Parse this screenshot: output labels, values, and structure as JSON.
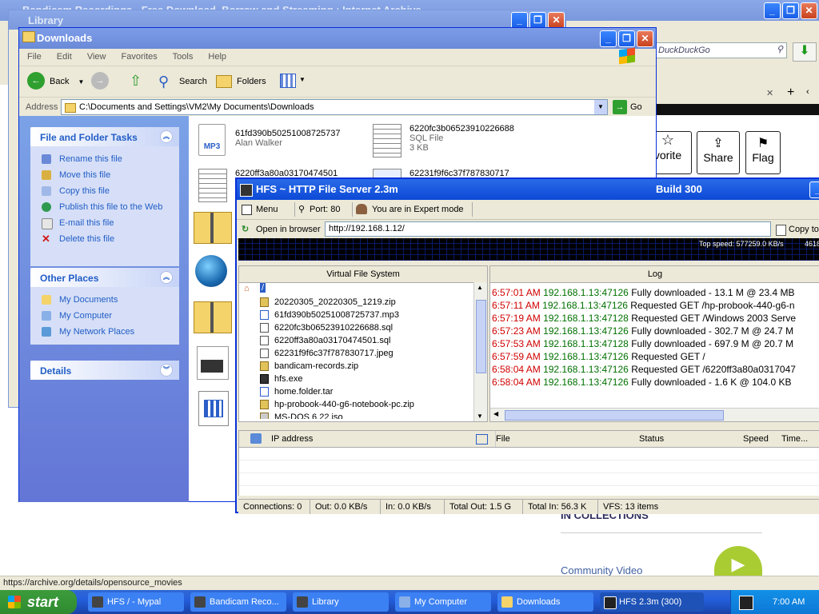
{
  "back_windows": {
    "library_title": "Library",
    "browser_title": "Bandicam Recordings - Free Download, Borrow and Streaming : Internet Archive",
    "browser_search": "DuckDuckGo",
    "browser_buttons": [
      "vorite",
      "Share",
      "Flag"
    ],
    "browser_collections": "IN COLLECTIONS",
    "browser_community": "Community Video",
    "status_url": "https://archive.org/details/opensource_movies"
  },
  "explorer": {
    "title": "Downloads",
    "menu": [
      "File",
      "Edit",
      "View",
      "Favorites",
      "Tools",
      "Help"
    ],
    "toolbar": {
      "back": "Back",
      "search": "Search",
      "folders": "Folders"
    },
    "address_label": "Address",
    "address_value": "C:\\Documents and Settings\\VM2\\My Documents\\Downloads",
    "go_label": "Go",
    "file_tasks": {
      "title": "File and Folder Tasks",
      "items": [
        "Rename this file",
        "Move this file",
        "Copy this file",
        "Publish this file to the Web",
        "E-mail this file",
        "Delete this file"
      ]
    },
    "other_places": {
      "title": "Other Places",
      "items": [
        "My Documents",
        "My Computer",
        "My Network Places"
      ]
    },
    "details_title": "Details",
    "files": [
      {
        "name": "61fd390b50251008725737",
        "sub": "Alan Walker"
      },
      {
        "name": "6220fc3b06523910226688",
        "sub": "SQL File",
        "sub2": "3 KB"
      },
      {
        "name": "6220ff3a80a03170474501"
      },
      {
        "name": "62231f9f6c37f787830717"
      }
    ]
  },
  "hfs": {
    "title": "HFS ~ HTTP File Server 2.3m",
    "build": "Build 300",
    "menu_label": "Menu",
    "port_label": "Port: 80",
    "mode_label": "You are in Expert mode",
    "open_browser": "Open in browser",
    "url": "http://192.168.1.12/",
    "copy_label": "Copy to",
    "top_speed": "Top speed: 577259.0 KB/s",
    "top_speed_tail": "4618",
    "vfs_header": "Virtual File System",
    "log_header": "Log",
    "vfs_items": [
      "20220305_20220305_1219.zip",
      "61fd390b50251008725737.mp3",
      "6220fc3b06523910226688.sql",
      "6220ff3a80a03170474501.sql",
      "62231f9f6c37f787830717.jpeg",
      "bandicam-records.zip",
      "hfs.exe",
      "home.folder.tar",
      "hp-probook-440-g6-notebook-pc.zip",
      "MS-DOS 6.22.iso"
    ],
    "log": [
      {
        "time": "6:57:01 AM",
        "ip": "192.168.1.13:47126",
        "msg": "Fully downloaded - 13.1 M @ 23.4 MB"
      },
      {
        "time": "6:57:11 AM",
        "ip": "192.168.1.13:47126",
        "msg": "Requested GET /hp-probook-440-g6-n"
      },
      {
        "time": "6:57:19 AM",
        "ip": "192.168.1.13:47128",
        "msg": "Requested GET /Windows 2003 Serve"
      },
      {
        "time": "6:57:23 AM",
        "ip": "192.168.1.13:47126",
        "msg": "Fully downloaded - 302.7 M @ 24.7 M"
      },
      {
        "time": "6:57:53 AM",
        "ip": "192.168.1.13:47128",
        "msg": "Fully downloaded - 697.9 M @ 20.7 M"
      },
      {
        "time": "6:57:59 AM",
        "ip": "192.168.1.13:47126",
        "msg": "Requested GET /"
      },
      {
        "time": "6:58:04 AM",
        "ip": "192.168.1.13:47126",
        "msg": "Requested GET /6220ff3a80a0317047"
      },
      {
        "time": "6:58:04 AM",
        "ip": "192.168.1.13:47126",
        "msg": "Fully downloaded - 1.6 K @ 104.0 KB"
      }
    ],
    "conn_headers": [
      "IP address",
      "File",
      "Status",
      "Speed",
      "Time..."
    ],
    "statusbar": [
      "Connections: 0",
      "Out: 0.0 KB/s",
      "In: 0.0 KB/s",
      "Total Out: 1.5 G",
      "Total In: 56.3 K",
      "VFS: 13 items"
    ]
  },
  "taskbar": {
    "start": "start",
    "buttons": [
      "HFS / - Mypal",
      "Bandicam Reco...",
      "Library",
      "My Computer",
      "Downloads",
      "HFS 2.3m (300)"
    ],
    "clock": "7:00 AM"
  },
  "colors": {
    "xp_blue": "#0a5fe8",
    "log_time": "#d00000",
    "log_ip": "#007000"
  }
}
